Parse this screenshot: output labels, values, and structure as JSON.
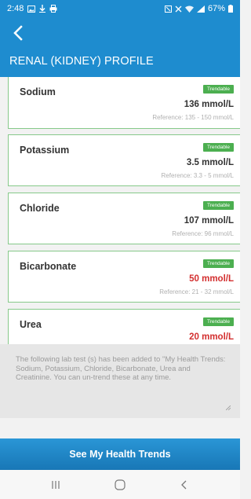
{
  "status_bar": {
    "time": "2:48",
    "battery": "67%",
    "icons": [
      "gallery-icon",
      "download-icon",
      "print-icon",
      "mute-icon",
      "nfc-icon",
      "wifi-icon",
      "signal-icon",
      "battery-icon"
    ]
  },
  "header": {
    "title": "RENAL (KIDNEY) PROFILE",
    "back_icon": "chevron-left-icon"
  },
  "tests": [
    {
      "name": "Sodium",
      "badge": "Trendable",
      "value": "136 mmol/L",
      "abnormal": false,
      "reference": "Reference: 135 - 150 mmol/L"
    },
    {
      "name": "Potassium",
      "badge": "Trendable",
      "value": "3.5 mmol/L",
      "abnormal": false,
      "reference": "Reference: 3.3 - 5 mmol/L"
    },
    {
      "name": "Chloride",
      "badge": "Trendable",
      "value": "107 mmol/L",
      "abnormal": false,
      "reference": "Reference: 96 mmol/L"
    },
    {
      "name": "Bicarbonate",
      "badge": "Trendable",
      "value": "50 mmol/L",
      "abnormal": true,
      "reference": "Reference: 21 - 32 mmol/L"
    },
    {
      "name": "Urea",
      "badge": "Trendable",
      "value": "20 mmol/L",
      "abnormal": true,
      "reference": ""
    }
  ],
  "notice": {
    "text": "The following lab test (s) has been added to \"My Health Trends: Sodium, Potassium, Chloride, Bicarbonate, Urea and Creatinine. You can un-trend these at any time."
  },
  "cta": {
    "label": "See My Health Trends"
  },
  "nav_bar": {
    "icons": [
      "recents-icon",
      "home-icon",
      "back-icon"
    ]
  },
  "colors": {
    "primary": "#1e8ccf",
    "badge_green": "#4caf50",
    "card_border": "#86c98a",
    "abnormal_red": "#d32f2f"
  }
}
